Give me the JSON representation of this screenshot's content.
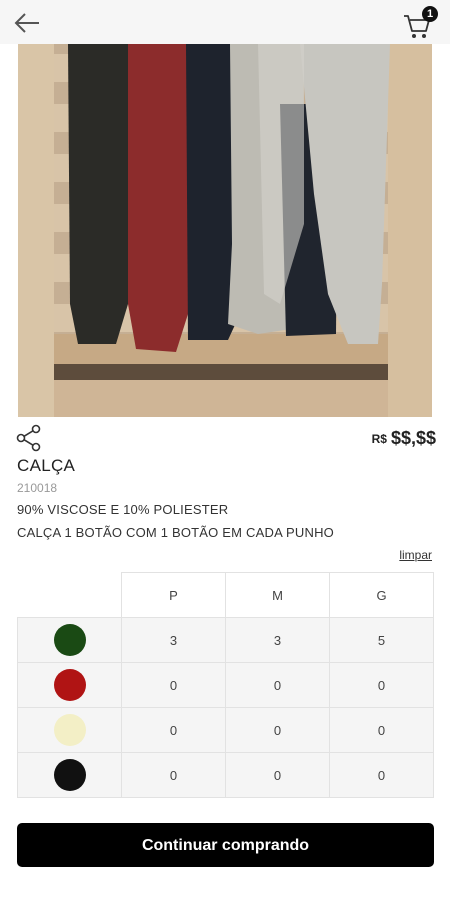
{
  "header": {
    "back_icon": "arrow-left-icon",
    "cart_icon": "shopping-cart-icon",
    "cart_count": "1"
  },
  "product": {
    "image_icon": "product-photo",
    "share_icon": "share-icon",
    "price_currency": "R$",
    "price_value": "$$,$$",
    "name": "CALÇA",
    "code": "210018",
    "description_line1": "90% VISCOSE E 10% POLIESTER",
    "description_line2": "CALÇA 1 BOTÃO COM 1 BOTÃO EM CADA PUNHO"
  },
  "grid": {
    "clear_label": "limpar",
    "sizes": [
      "P",
      "M",
      "G"
    ],
    "rows": [
      {
        "color": "#1a4a14",
        "quantities": [
          "3",
          "3",
          "5"
        ]
      },
      {
        "color": "#b01414",
        "quantities": [
          "0",
          "0",
          "0"
        ]
      },
      {
        "color": "#f3efc6",
        "quantities": [
          "0",
          "0",
          "0"
        ]
      },
      {
        "color": "#111111",
        "quantities": [
          "0",
          "0",
          "0"
        ]
      }
    ]
  },
  "footer": {
    "continue_label": "Continuar comprando"
  }
}
